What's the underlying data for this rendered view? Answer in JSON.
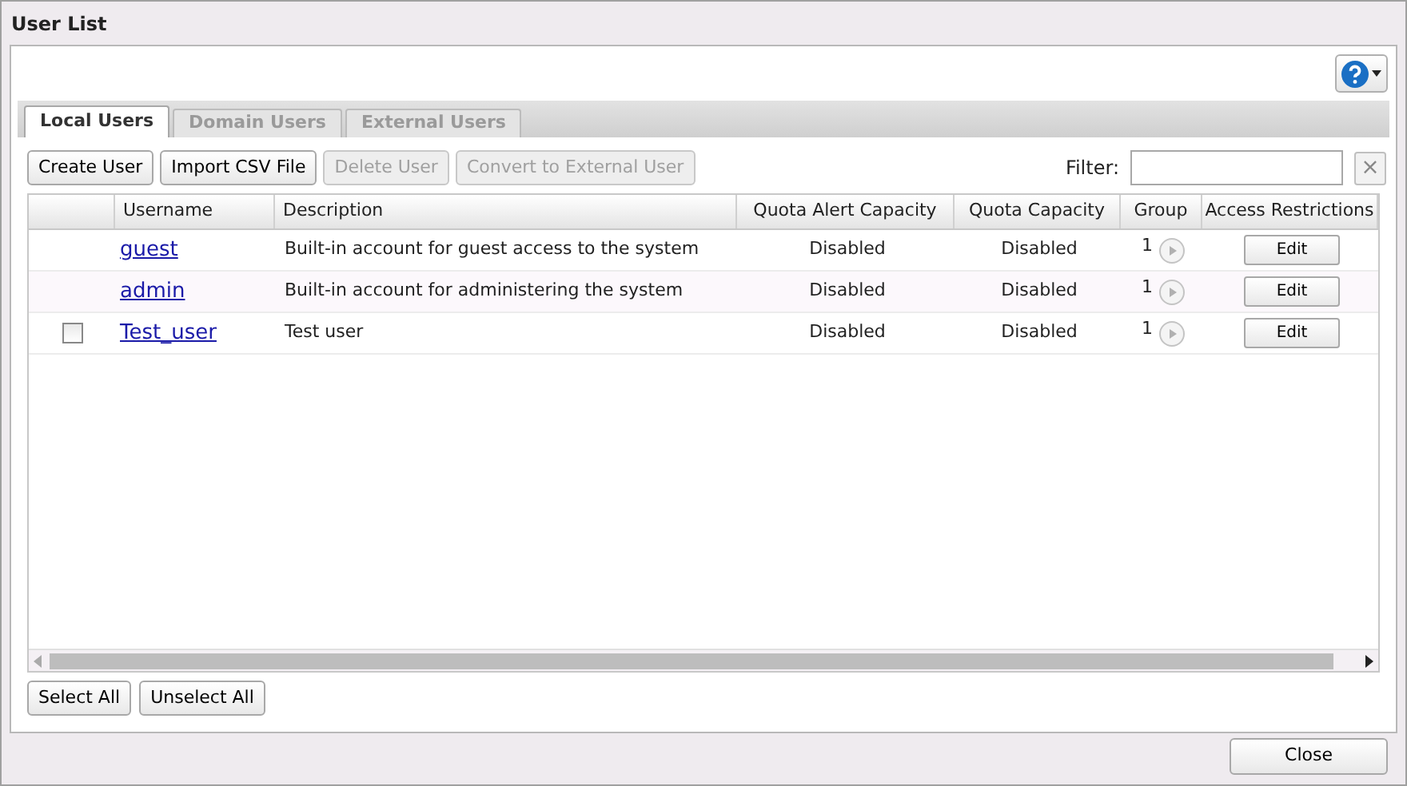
{
  "window": {
    "title": "User List"
  },
  "tabs": [
    {
      "label": "Local Users",
      "selected": true,
      "disabled": false
    },
    {
      "label": "Domain Users",
      "selected": false,
      "disabled": true
    },
    {
      "label": "External Users",
      "selected": false,
      "disabled": true
    }
  ],
  "toolbar": [
    {
      "label": "Create User",
      "disabled": false
    },
    {
      "label": "Import CSV File",
      "disabled": false
    },
    {
      "label": "Delete User",
      "disabled": true
    },
    {
      "label": "Convert to External User",
      "disabled": true
    }
  ],
  "filter": {
    "label": "Filter:",
    "clear": "×"
  },
  "table": {
    "columns": [
      "Username",
      "Description",
      "Quota Alert Capacity",
      "Quota Capacity",
      "Group",
      "Access Restrictions"
    ],
    "rows": [
      {
        "username": "guest",
        "description": "Built-in account for guest access to the system",
        "quota_alert": "Disabled",
        "quota": "Disabled",
        "group": "1",
        "action": "Edit"
      },
      {
        "username": "admin",
        "description": "Built-in account for administering the system",
        "quota_alert": "Disabled",
        "quota": "Disabled",
        "group": "1",
        "action": "Edit"
      },
      {
        "username": "Test_user",
        "description": "Test user",
        "quota_alert": "Disabled",
        "quota": "Disabled",
        "group": "1",
        "action": "Edit",
        "checkbox": {
          "checked": false
        }
      }
    ]
  },
  "selection_buttons": [
    "Select All",
    "Unselect All"
  ],
  "buttons": [
    "Close"
  ]
}
